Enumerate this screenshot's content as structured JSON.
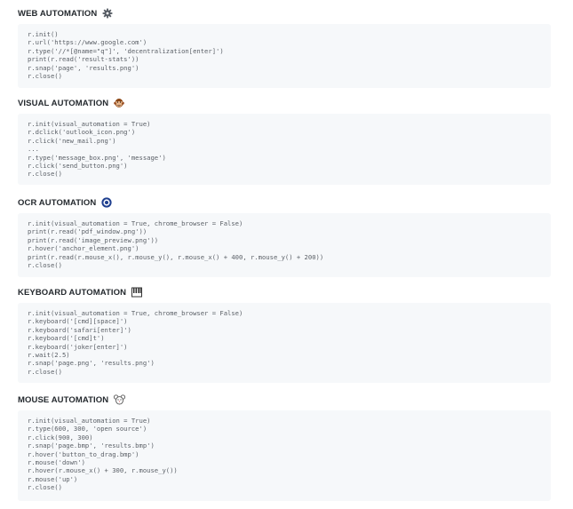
{
  "sections": [
    {
      "title": "WEB AUTOMATION",
      "icon": "gear-icon",
      "lines": [
        "r.init()",
        "r.url('https://www.google.com')",
        "r.type('//*[@name=\"q\"]', 'decentralization[enter]')",
        "print(r.read('result-stats'))",
        "r.snap('page', 'results.png')",
        "r.close()"
      ]
    },
    {
      "title": "VISUAL AUTOMATION",
      "icon": "monkey-face-icon",
      "lines": [
        "r.init(visual_automation = True)",
        "r.dclick('outlook_icon.png')",
        "r.click('new_mail.png')",
        "...",
        "r.type('message_box.png', 'message')",
        "r.click('send_button.png')",
        "r.close()"
      ]
    },
    {
      "title": "OCR AUTOMATION",
      "icon": "target-eye-icon",
      "lines": [
        "r.init(visual_automation = True, chrome_browser = False)",
        "print(r.read('pdf_window.png'))",
        "print(r.read('image_preview.png'))",
        "r.hover('anchor_element.png')",
        "print(r.read(r.mouse_x(), r.mouse_y(), r.mouse_x() + 400, r.mouse_y() + 200))",
        "r.close()"
      ]
    },
    {
      "title": "KEYBOARD AUTOMATION",
      "icon": "keyboard-icon",
      "lines": [
        "r.init(visual_automation = True, chrome_browser = False)",
        "r.keyboard('[cmd][space]')",
        "r.keyboard('safari[enter]')",
        "r.keyboard('[cmd]t')",
        "r.keyboard('joker[enter]')",
        "r.wait(2.5)",
        "r.snap('page.png', 'results.png')",
        "r.close()"
      ]
    },
    {
      "title": "MOUSE AUTOMATION",
      "icon": "mouse-icon",
      "lines": [
        "r.init(visual_automation = True)",
        "r.type(600, 300, 'open source')",
        "r.click(900, 300)",
        "r.snap('page.bmp', 'results.bmp')",
        "r.hover('button_to_drag.bmp')",
        "r.mouse('down')",
        "r.hover(r.mouse_x() + 300, r.mouse_y())",
        "r.mouse('up')",
        "r.close()"
      ]
    }
  ]
}
